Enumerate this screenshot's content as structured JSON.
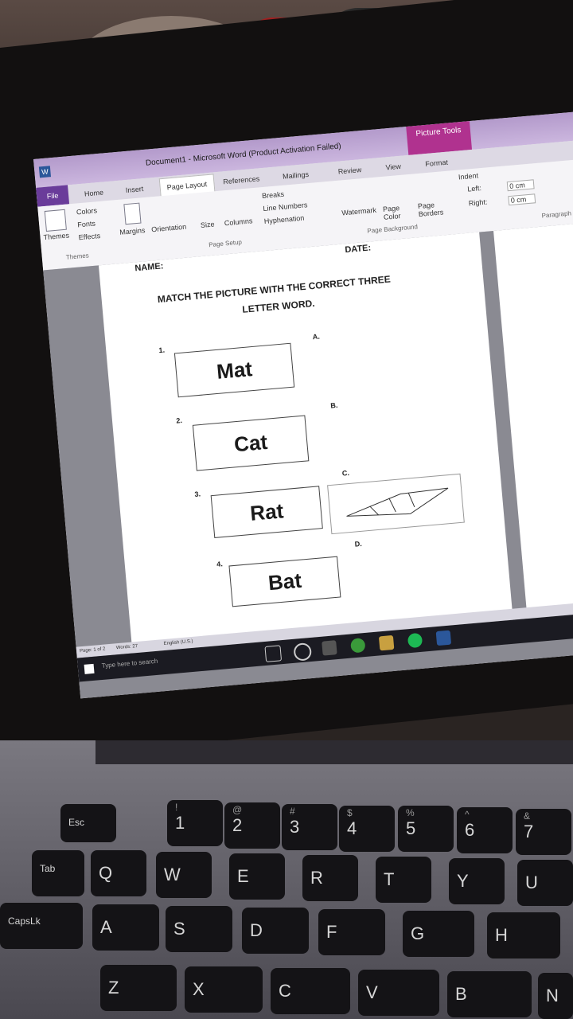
{
  "window": {
    "title": "Document1 - Microsoft Word (Product Activation Failed)",
    "context_tab": "Picture Tools"
  },
  "tabs": {
    "file": "File",
    "home": "Home",
    "insert": "Insert",
    "page_layout": "Page Layout",
    "references": "References",
    "mailings": "Mailings",
    "review": "Review",
    "view": "View",
    "format": "Format"
  },
  "ribbon": {
    "themes": "Themes",
    "colors": "Colors",
    "fonts": "Fonts",
    "effects": "Effects",
    "themes_group": "Themes",
    "margins": "Margins",
    "orientation": "Orientation",
    "size": "Size",
    "columns": "Columns",
    "breaks": "Breaks",
    "line_numbers": "Line Numbers",
    "hyphenation": "Hyphenation",
    "page_setup_group": "Page Setup",
    "watermark": "Watermark",
    "page_color": "Page Color",
    "page_borders": "Page Borders",
    "page_background_group": "Page Background",
    "indent": "Indent",
    "left_label": "Left:",
    "left_value": "0 cm",
    "right_label": "Right:",
    "right_value": "0 cm",
    "paragraph_group": "Paragraph"
  },
  "document": {
    "name_label": "NAME:",
    "date_label": "DATE:",
    "heading_line1": "MATCH THE PICTURE WITH THE CORRECT THREE",
    "heading_line2": "LETTER WORD.",
    "items": [
      {
        "num": "1.",
        "word": "Mat"
      },
      {
        "num": "2.",
        "word": "Cat"
      },
      {
        "num": "3.",
        "word": "Rat"
      },
      {
        "num": "4.",
        "word": "Bat"
      }
    ],
    "letters": [
      "A.",
      "B.",
      "C.",
      "D."
    ]
  },
  "statusbar": {
    "page": "Page: 1 of 2",
    "words": "Words: 27",
    "language": "English (U.S.)"
  },
  "taskbar": {
    "search_placeholder": "Type here to search"
  },
  "keyboard": {
    "row1": [
      {
        "main": "Esc",
        "top": ""
      },
      {
        "main": "1",
        "top": "!"
      },
      {
        "main": "2",
        "top": "@"
      },
      {
        "main": "3",
        "top": "#"
      },
      {
        "main": "4",
        "top": "$"
      },
      {
        "main": "5",
        "top": "%"
      },
      {
        "main": "6",
        "top": "^"
      },
      {
        "main": "7",
        "top": "&"
      }
    ],
    "row2": [
      "Tab",
      "Q",
      "W",
      "E",
      "R",
      "T",
      "Y",
      "U"
    ],
    "row3": [
      "CapsLk",
      "A",
      "S",
      "D",
      "F",
      "G",
      "H"
    ],
    "row4": [
      "Z",
      "X",
      "C",
      "V",
      "B",
      "N"
    ]
  },
  "colors": {
    "word_purple": "#6a3c9a",
    "picture_tools": "#b0328f"
  }
}
